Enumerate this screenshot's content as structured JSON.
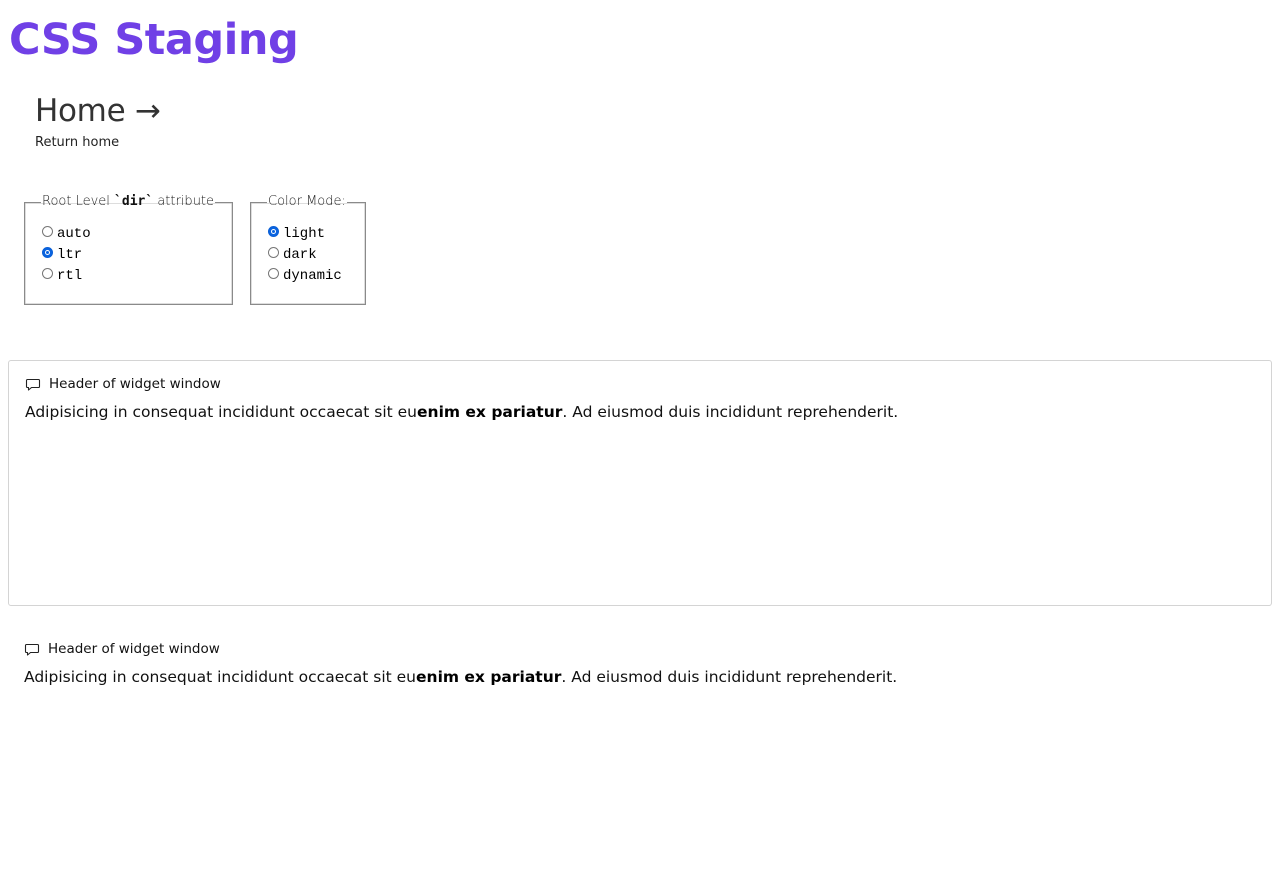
{
  "site": {
    "title": "CSS Staging",
    "title_color": "#7040e6"
  },
  "home": {
    "heading": "Home →",
    "subtitle": "Return home"
  },
  "dir_fieldset": {
    "legend_prefix": "Root Level ",
    "legend_code": "`dir`",
    "legend_suffix": " attribute",
    "options": [
      {
        "label": "auto",
        "checked": false
      },
      {
        "label": "ltr",
        "checked": true
      },
      {
        "label": "rtl",
        "checked": false
      }
    ]
  },
  "color_fieldset": {
    "legend": "Color Mode:",
    "options": [
      {
        "label": "light",
        "checked": true
      },
      {
        "label": "dark",
        "checked": false
      },
      {
        "label": "dynamic",
        "checked": false
      }
    ]
  },
  "widgets": [
    {
      "icon": "chat-bubble-icon",
      "header": "Header of widget window",
      "body_before": "Adipisicing in consequat incididunt occaecat sit eu",
      "body_bold": "enim ex pariatur",
      "body_after": ". Ad eiusmod duis incididunt reprehenderit."
    },
    {
      "icon": "chat-bubble-icon",
      "header": "Header of widget window",
      "body_before": "Adipisicing in consequat incididunt occaecat sit eu",
      "body_bold": "enim ex pariatur",
      "body_after": ". Ad eiusmod duis incididunt reprehenderit."
    }
  ],
  "colors": {
    "accent": "#7040e6",
    "radio_checked": "#0a64e0",
    "widget_border": "#d4d4d4"
  }
}
